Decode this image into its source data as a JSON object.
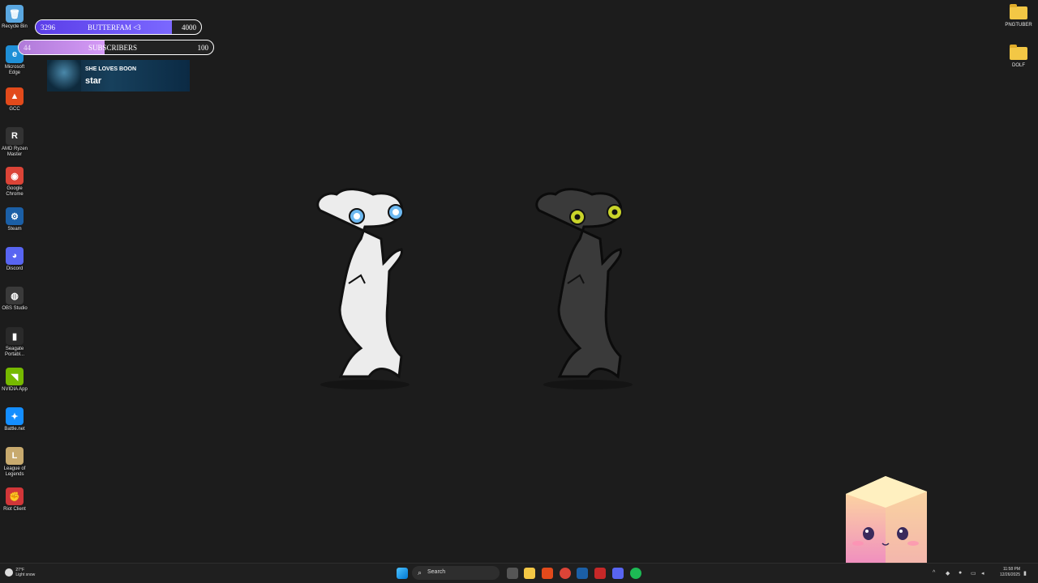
{
  "desktop_left_icons": [
    {
      "label": "Recycle Bin",
      "color": "#5aa7e0",
      "glyph": "🗑"
    },
    {
      "label": "Microsoft Edge",
      "color": "#1f8fd6",
      "glyph": "e"
    },
    {
      "label": "GCC",
      "color": "#e24a1b",
      "glyph": "▲"
    },
    {
      "label": "AMD Ryzen Master",
      "color": "#333333",
      "glyph": "R"
    },
    {
      "label": "Google Chrome",
      "color": "#db4437",
      "glyph": "◉"
    },
    {
      "label": "Steam",
      "color": "#1b5fa6",
      "glyph": "⚙"
    },
    {
      "label": "Discord",
      "color": "#5865f2",
      "glyph": "◕"
    },
    {
      "label": "OBS Studio",
      "color": "#3a3a3a",
      "glyph": "◍"
    },
    {
      "label": "Seagate Portabl...",
      "color": "#2a2a2a",
      "glyph": "▮"
    },
    {
      "label": "NVIDIA App",
      "color": "#76b900",
      "glyph": "◥"
    },
    {
      "label": "Battle.net",
      "color": "#148eff",
      "glyph": "✦"
    },
    {
      "label": "League of Legends",
      "color": "#c8aa6e",
      "glyph": "L"
    },
    {
      "label": "Riot Client",
      "color": "#d13639",
      "glyph": "✊"
    }
  ],
  "goal_bars": [
    {
      "current": "3296",
      "title": "BUTTERFAM <3",
      "target": "4000",
      "progress": 0.824,
      "fill": "#5b3ee8",
      "fill2": "#7b68ff"
    },
    {
      "current": "44",
      "title": "SUBSCRIBERS",
      "target": "100",
      "progress": 0.44,
      "fill": "#b07ad9",
      "fill2": "#d49af5"
    }
  ],
  "alert": {
    "title": "SHE LOVES BOON",
    "message": "star"
  },
  "desktop_right_icons": [
    {
      "label": "PNGTUBER"
    },
    {
      "label": "DOLF"
    }
  ],
  "taskbar": {
    "search_label": "Search",
    "weather_temp": "27°F",
    "weather_desc": "Light snow",
    "time": "11:58 PM",
    "date": "12/26/2025"
  },
  "colors": {
    "background": "#1c1c1c",
    "white_toothless_eye": "#6cb8f0",
    "black_toothless_eye": "#c9d42a"
  }
}
